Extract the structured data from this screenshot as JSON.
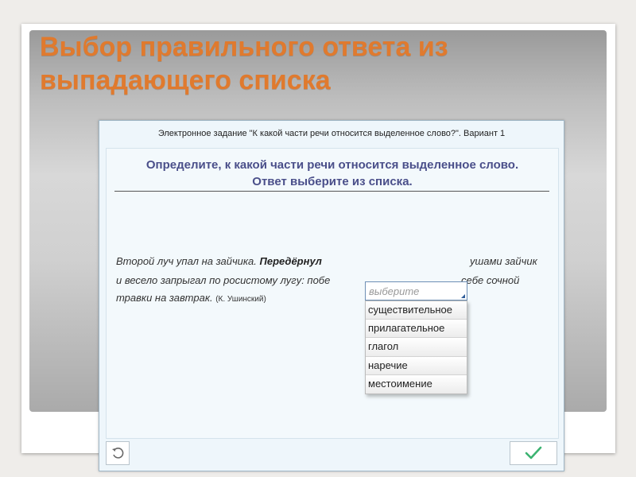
{
  "slide": {
    "title_line1": "Выбор правильного ответа из",
    "title_line2": "выпадающего списка"
  },
  "task": {
    "header": "Электронное задание \"К какой части речи относится выделенное слово?\". Вариант 1",
    "instruction_line1": "Определите, к какой части речи относится выделенное слово.",
    "instruction_line2": "Ответ выберите из списка.",
    "passage": {
      "line1_before": "Второй луч упал на зайчика. ",
      "highlighted_word": "Передёрнул",
      "line1_after": "ушами зайчик",
      "line2_before": "и весело запрыгал по росистому лугу: побе",
      "line2_after": "себе сочной",
      "line3": "травки на завтрак. ",
      "attribution": "(К. Ушинский)"
    },
    "dropdown": {
      "selected_placeholder": "выберите",
      "options": [
        "существительное",
        "прилагательное",
        "глагол",
        "наречие",
        "местоимение"
      ]
    },
    "buttons": {
      "undo_icon": "undo-icon",
      "check_icon": "checkmark-icon"
    }
  },
  "colors": {
    "title": "#e07a2e",
    "instruction": "#4a4f8a",
    "check": "#3cb371"
  }
}
